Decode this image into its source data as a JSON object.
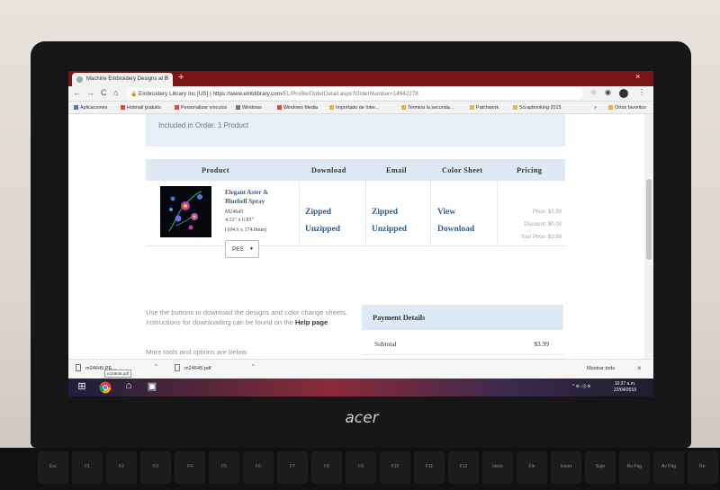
{
  "browser": {
    "tab_title": "Machine Embroidery Designs at E",
    "tab_close": "×",
    "new_tab": "+",
    "window_close": "×",
    "nav": {
      "back": "←",
      "forward": "→",
      "reload": "C",
      "home": "⌂"
    },
    "omnibox": {
      "site": "Embroidery Library Inc [US]",
      "separator": "|",
      "url_base": "https://www.emblibrary.com",
      "url_path": "/EL/Profile/OrderDetail.aspx?OrderNumber=14942278"
    },
    "toolbar_icons": {
      "star": "☆",
      "extension": "◉",
      "menu": "⋮"
    }
  },
  "bookmarks": [
    {
      "label": "Aplicaciones",
      "color": "#4a78c9"
    },
    {
      "label": "Hotmail gratuito",
      "color": "#e04b2b"
    },
    {
      "label": "Personalizar vínculos",
      "color": "#e04b2b"
    },
    {
      "label": "Windows",
      "color": "#777777"
    },
    {
      "label": "Windows Media",
      "color": "#e04b2b"
    },
    {
      "label": "Importado de Inter...",
      "color": "#e8b34a"
    },
    {
      "label": "Termina la secunda...",
      "color": "#e8b34a"
    },
    {
      "label": "Patchwork",
      "color": "#e8b34a"
    },
    {
      "label": "Scrapbooking 2015",
      "color": "#e8b34a"
    },
    {
      "label": "»",
      "color": ""
    },
    {
      "label": "Otros favoritos",
      "color": "#e8b34a"
    }
  ],
  "order": {
    "included_text": "Included in Order: 1 Product"
  },
  "table": {
    "headers": [
      "Product",
      "Download",
      "Email",
      "Color Sheet",
      "Pricing"
    ],
    "row": {
      "product_name": "Elegant Aster & Bluebell Spray",
      "sku": "M24645",
      "size_in": "4.12\" x 6.85\"",
      "size_mm": "(104.6 x 174.0mm)",
      "format": "PES",
      "download_zipped": "Zipped",
      "download_unzipped": "Unzipped",
      "email_zipped": "Zipped",
      "email_unzipped": "Unzipped",
      "color_view": "View",
      "color_download": "Download",
      "price": "Price: $3.99",
      "discount": "Discount: $0.00",
      "your_price": "Your Price: $3.99"
    }
  },
  "help": {
    "text": "Use the buttons to download the designs and color change sheets. Instructions for downloading can be found on the",
    "link": "Help page",
    "more_tools": "More tools and options are below."
  },
  "payment": {
    "heading": "Payment Details",
    "subtotal_label": "Subtotal",
    "subtotal_value": "$3.99"
  },
  "downloads_bar": {
    "item1": "m24645.PE...",
    "item1_tooltip": "m24645.pdf",
    "item2": "m24645.pdf",
    "caret": "^",
    "show_all": "Mostrar todo",
    "close": "×"
  },
  "taskbar": {
    "start": "⊞",
    "clock_time": "10:27 a.m.",
    "clock_date": "22/04/2019",
    "tray": "^ ⊕ ◁) ⊗"
  },
  "laptop": {
    "brand": "acer",
    "fkeys": [
      "Esc",
      "F1",
      "F2",
      "F3",
      "F4",
      "F5",
      "F6",
      "F7",
      "F8",
      "F9",
      "F10",
      "F11",
      "F12",
      "Inicio",
      "Fin",
      "Insert",
      "Supr",
      "Re Pág",
      "Av Pág",
      "Re."
    ]
  }
}
